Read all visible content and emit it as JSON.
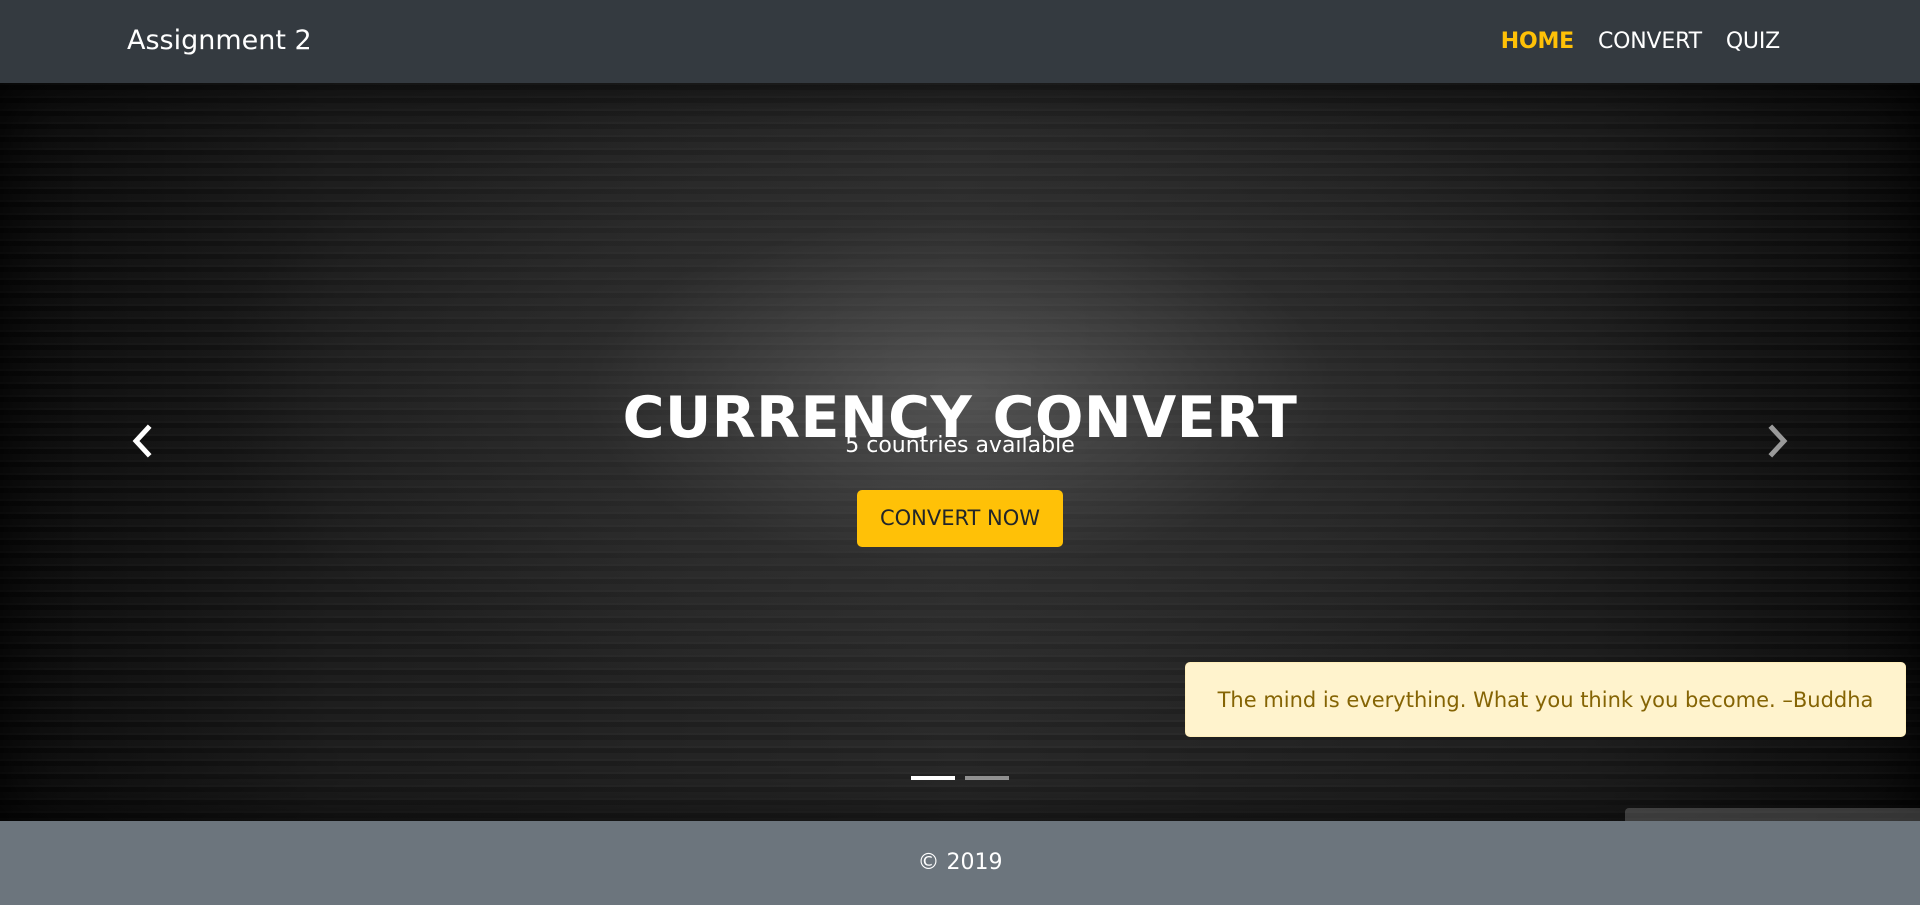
{
  "navbar": {
    "brand": "Assignment 2",
    "links": [
      {
        "label": "HOME",
        "active": true
      },
      {
        "label": "CONVERT",
        "active": false
      },
      {
        "label": "QUIZ",
        "active": false
      }
    ]
  },
  "hero": {
    "title": "CURRENCY CONVERT",
    "subtitle": "5 countries available",
    "button_label": "CONVERT NOW",
    "prev_icon": "chevron-left-icon",
    "next_icon": "chevron-right-icon",
    "slides_total": 2,
    "active_slide": 1
  },
  "quote": {
    "text": "The mind is everything. What you think you become. –Buddha"
  },
  "footer": {
    "text": "© 2019"
  },
  "colors": {
    "navbar_bg": "#343a40",
    "accent": "#ffc107",
    "footer_bg": "#6c757d",
    "alert_bg": "#fff3cd",
    "alert_text": "#856404"
  }
}
